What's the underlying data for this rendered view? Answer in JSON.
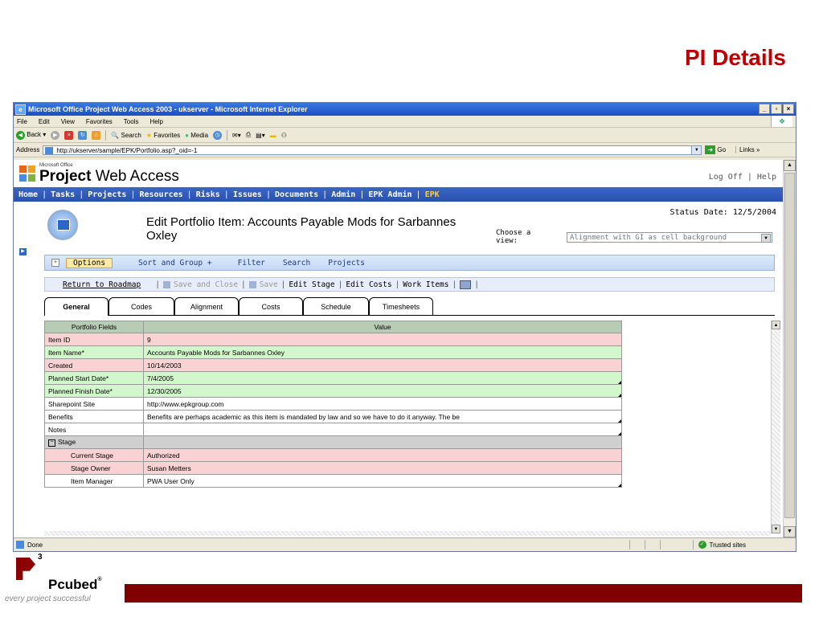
{
  "slide_title": "PI Details",
  "browser": {
    "title": "Microsoft Office Project Web Access 2003 - ukserver - Microsoft Internet Explorer",
    "menu": [
      "File",
      "Edit",
      "View",
      "Favorites",
      "Tools",
      "Help"
    ],
    "toolbar": {
      "back": "Back",
      "search": "Search",
      "favorites": "Favorites",
      "media": "Media"
    },
    "address_label": "Address",
    "url": "http://ukserver/sample/EPK/Portfolio.asp?_oid=-1",
    "go": "Go",
    "links": "Links",
    "status": "Done",
    "zone": "Trusted sites"
  },
  "pwa": {
    "ms_label": "Microsoft Office",
    "brand_bold": "Project",
    "brand_rest": " Web Access",
    "header_links": "Log Off | Help",
    "nav": [
      "Home",
      "Tasks",
      "Projects",
      "Resources",
      "Risks",
      "Issues",
      "Documents",
      "Admin",
      "EPK Admin"
    ],
    "nav_active": "EPK",
    "status_date": "Status Date: 12/5/2004",
    "page_title": "Edit Portfolio Item: Accounts Payable Mods for Sarbannes Oxley",
    "choose_view": "Choose a view:",
    "view_selected": "Alignment with GI as cell background",
    "options_bar": {
      "options": "Options",
      "items": [
        "Sort and Group +",
        "Filter",
        "Search",
        "Projects"
      ]
    },
    "actions": {
      "return": "Return to Roadmap",
      "save_close": "Save and Close",
      "save": "Save",
      "edit_stage": "Edit Stage",
      "edit_costs": "Edit Costs",
      "work_items": "Work Items"
    },
    "tabs": [
      "General",
      "Codes",
      "Alignment",
      "Costs",
      "Schedule",
      "Timesheets"
    ],
    "grid": {
      "headers": [
        "Portfolio Fields",
        "Value"
      ],
      "rows": [
        {
          "field": "Item ID",
          "value": "9",
          "color": "pink"
        },
        {
          "field": "Item Name*",
          "value": "Accounts Payable Mods for Sarbannes Oxley",
          "color": "green"
        },
        {
          "field": "Created",
          "value": "10/14/2003",
          "color": "pink"
        },
        {
          "field": "Planned Start Date*",
          "value": "7/4/2005",
          "color": "green"
        },
        {
          "field": "Planned Finish Date*",
          "value": "12/30/2005",
          "color": "green"
        },
        {
          "field": "Sharepoint Site",
          "value": "http://www.epkgroup.com",
          "color": "white"
        },
        {
          "field": "Benefits",
          "value": "Benefits are perhaps academic as this item is mandated by law and so we have to do it anyway. The be",
          "color": "white"
        },
        {
          "field": "Notes",
          "value": "",
          "color": "white"
        }
      ],
      "stage_label": "Stage",
      "stage_rows": [
        {
          "field": "Current Stage",
          "value": "Authorized",
          "color": "pink"
        },
        {
          "field": "Stage Owner",
          "value": "Susan Metters",
          "color": "pink"
        },
        {
          "field": "Item Manager",
          "value": "PWA User Only",
          "color": "white"
        }
      ]
    }
  },
  "footer": {
    "superscript": "3",
    "brand": "Pcubed",
    "tagline": "every project successful"
  }
}
